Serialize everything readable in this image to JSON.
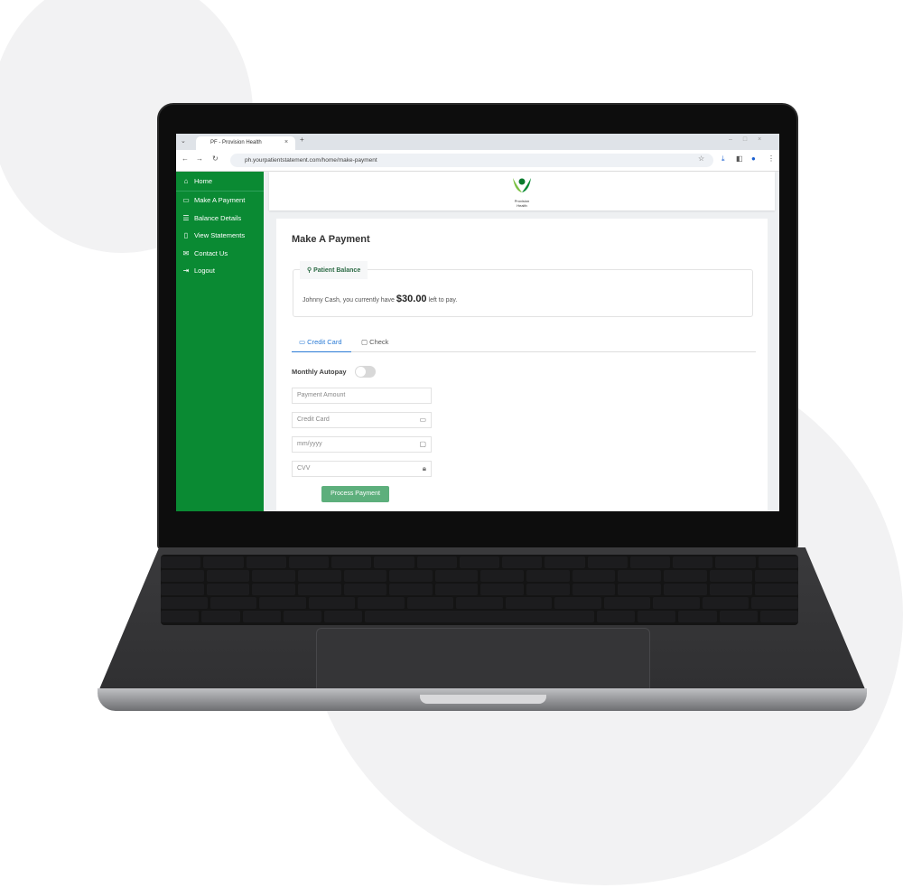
{
  "browser": {
    "tab_title": "PF - Provision Health",
    "url": "ph.yourpatientstatement.com/home/make-payment"
  },
  "logo": {
    "text": "Provision Health"
  },
  "sidebar": {
    "items": [
      {
        "label": "Home",
        "icon": "home-icon"
      },
      {
        "label": "Make A Payment",
        "icon": "card-icon"
      },
      {
        "label": "Balance Details",
        "icon": "list-icon"
      },
      {
        "label": "View Statements",
        "icon": "document-icon"
      },
      {
        "label": "Contact Us",
        "icon": "mail-icon"
      },
      {
        "label": "Logout",
        "icon": "logout-icon"
      }
    ]
  },
  "main": {
    "title": "Make A Payment",
    "balance": {
      "legend": "Patient Balance",
      "prefix": "Johnny Cash, you currently have",
      "amount": "$30.00",
      "suffix": "left to pay."
    },
    "tabs": [
      {
        "label": "Credit Card",
        "active": true
      },
      {
        "label": "Check",
        "active": false
      }
    ],
    "autopay_label": "Monthly Autopay",
    "autopay_on": false,
    "fields": {
      "amount": "Payment Amount",
      "card": "Credit Card",
      "expiry": "mm/yyyy",
      "cvv": "CVV"
    },
    "submit": "Process Payment"
  },
  "colors": {
    "sidebar": "#0a8a33",
    "accent": "#5daf7c",
    "tab_active": "#2b7bd6"
  }
}
